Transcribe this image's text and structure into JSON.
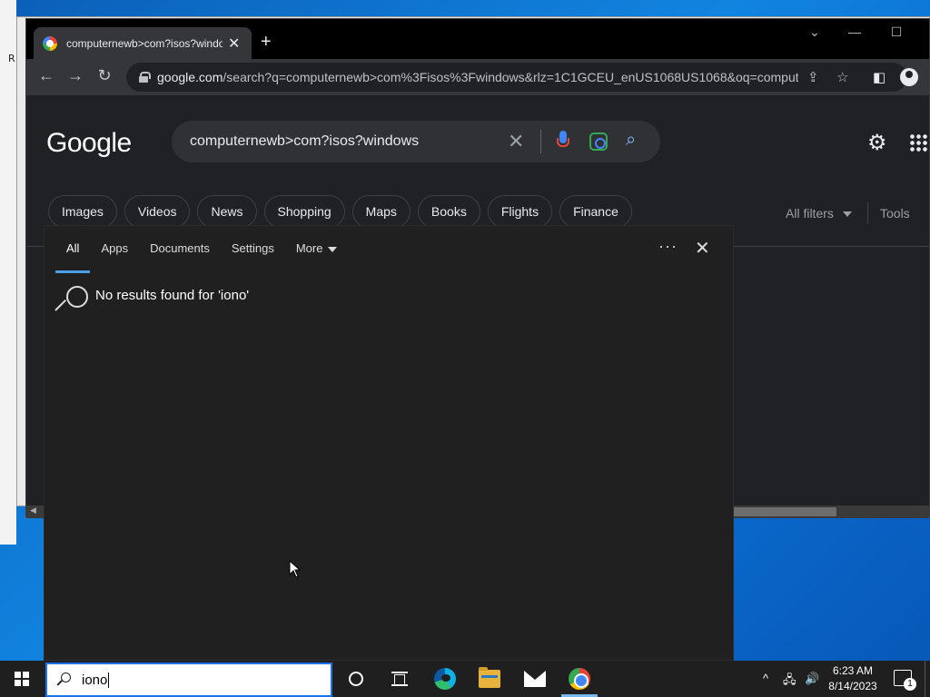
{
  "desktop": {
    "edge_glyph": "R"
  },
  "browser": {
    "tab_title": "computernewb>com?isos?windo",
    "tab_close": "✕",
    "new_tab": "+",
    "window_controls": {
      "dropdown": "⌄",
      "minimize": "—",
      "maximize": "☐"
    },
    "url_domain": "google.com",
    "url_path": "/search?q=computernewb>com%3Fisos%3Fwindows&rlz=1C1GCEU_enUS1068US1068&oq=comput...",
    "icons": [
      "back-icon",
      "forward-icon",
      "reload-icon",
      "lock-icon",
      "share-icon",
      "star-icon",
      "side-panel-icon",
      "profile-icon"
    ]
  },
  "google": {
    "logo": "Google",
    "query": "computernewb>com?isos?windows",
    "chips": [
      "Images",
      "Videos",
      "News",
      "Shopping",
      "Maps",
      "Books",
      "Flights",
      "Finance"
    ],
    "all_filters": "All filters",
    "tools": "Tools"
  },
  "search_panel": {
    "tabs": [
      "All",
      "Apps",
      "Documents",
      "Settings",
      "More"
    ],
    "active_tab": "All",
    "empty_message": "No results found for 'iono'"
  },
  "taskbar": {
    "search_value": "iono",
    "time": "6:23 AM",
    "date": "8/14/2023",
    "notification_count": "1",
    "pinned_apps": [
      "cortana",
      "task-view",
      "edge",
      "file-explorer",
      "mail",
      "chrome"
    ],
    "accent": "#76b9ed"
  }
}
